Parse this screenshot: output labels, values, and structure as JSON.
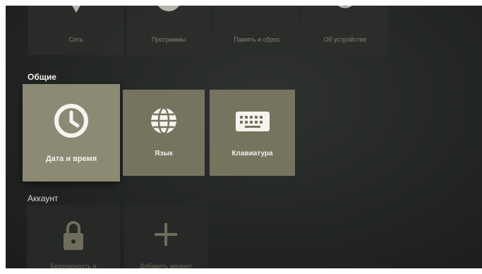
{
  "top_row": [
    {
      "label": "Сеть",
      "icon": "wifi-icon"
    },
    {
      "label": "Программы",
      "icon": "apps-icon"
    },
    {
      "label": "Память и сброс",
      "icon": "storage-icon"
    },
    {
      "label": "Об устройстве",
      "icon": "info-icon"
    }
  ],
  "general": {
    "title": "Общие",
    "items": [
      {
        "label": "Дата и время",
        "icon": "clock-icon"
      },
      {
        "label": "Язык",
        "icon": "globe-icon"
      },
      {
        "label": "Клавиатура",
        "icon": "keyboard-icon"
      }
    ]
  },
  "account": {
    "title": "Аккаунт",
    "items": [
      {
        "label": "Безопасность и",
        "icon": "lock-icon"
      },
      {
        "label": "Добавить аккаунт",
        "icon": "plus-icon"
      }
    ]
  },
  "colors": {
    "focused_tile": "#8c8a75",
    "tile": "#76735f",
    "background": "#232625"
  }
}
